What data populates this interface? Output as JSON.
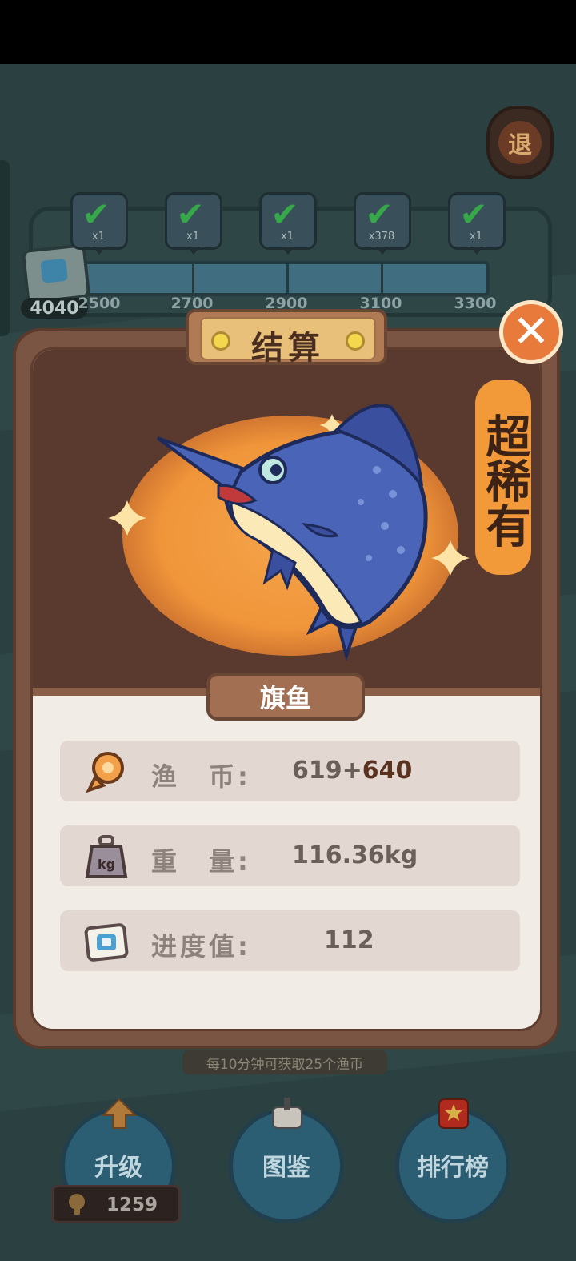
{
  "header": {
    "exit_label": "退"
  },
  "progress": {
    "current": "4040",
    "fill_fraction": 1.0,
    "milestones": [
      {
        "mult": "x1",
        "label": "2500"
      },
      {
        "mult": "x1",
        "label": "2700"
      },
      {
        "mult": "x1",
        "label": "2900"
      },
      {
        "mult": "x378",
        "label": "3100"
      },
      {
        "mult": "x1",
        "label": "3300"
      }
    ]
  },
  "modal": {
    "title": "结算",
    "rarity": "超稀有",
    "fish_name": "旗鱼",
    "rows": [
      {
        "label": "渔　币:",
        "base": "619+",
        "bonus": "640",
        "icon": "fish-coin-icon"
      },
      {
        "label": "重　量:",
        "base": "116.36kg",
        "bonus": "",
        "icon": "weight-kg-icon"
      },
      {
        "label": "进度值:",
        "base": "112",
        "bonus": "",
        "icon": "progress-ticket-icon"
      }
    ]
  },
  "footer": {
    "hint": "每10分钟可获取25个渔币",
    "upgrade_label": "升级",
    "catalog_label": "图鉴",
    "ranking_label": "排行榜",
    "coins": "1259"
  },
  "colors": {
    "accent_orange": "#f29a3a",
    "modal_brown": "#7b5543",
    "close_orange": "#e87a3c"
  }
}
